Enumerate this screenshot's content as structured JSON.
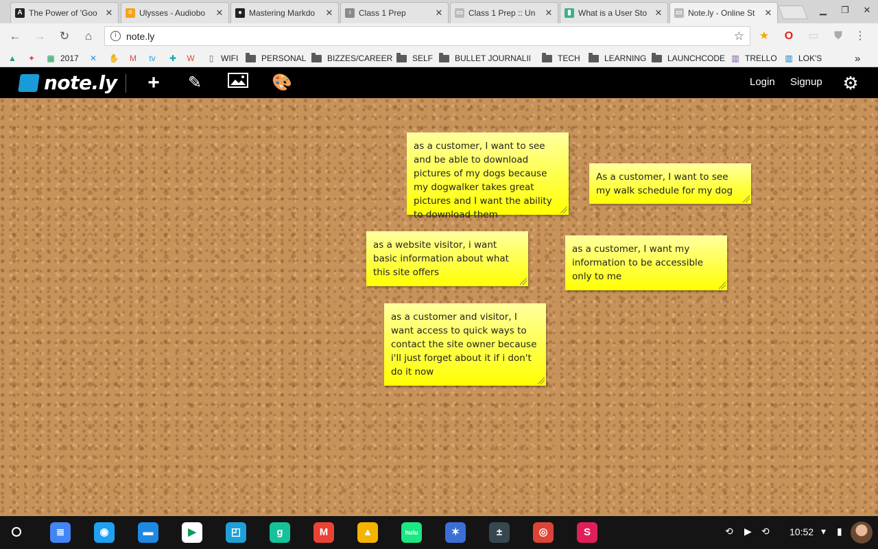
{
  "tabs": [
    {
      "title": "The Power of 'Goo",
      "favicon": "A",
      "color": "#222"
    },
    {
      "title": "Ulysses - Audiobo",
      "favicon": "≡",
      "color": "#f7a21b"
    },
    {
      "title": "Mastering Markdo",
      "favicon": "●",
      "color": "#222"
    },
    {
      "title": "Class 1 Prep",
      "favicon": "♀",
      "color": "#8a8a8a"
    },
    {
      "title": "Class 1 Prep :: Un",
      "favicon": "▭",
      "color": "#bbb"
    },
    {
      "title": "What is a User Sto",
      "favicon": "▮",
      "color": "#3bb08f"
    },
    {
      "title": "Note.ly - Online St",
      "favicon": "▭",
      "color": "#bbb"
    }
  ],
  "toolbar": {
    "url": "note.ly"
  },
  "bookmarks": [
    {
      "label": "",
      "icon": "▲",
      "color": "#1fa463"
    },
    {
      "label": "",
      "icon": "✦",
      "color": "#e44"
    },
    {
      "label": "2017",
      "icon": "▦",
      "color": "#0f9d58"
    },
    {
      "label": "",
      "icon": "✕",
      "color": "#2196f3"
    },
    {
      "label": "",
      "icon": "✋",
      "color": "#3a7"
    },
    {
      "label": "",
      "icon": "M",
      "color": "#d44"
    },
    {
      "label": "",
      "icon": "tv",
      "color": "#2aa0d8"
    },
    {
      "label": "",
      "icon": "✚",
      "color": "#1aa"
    },
    {
      "label": "",
      "icon": "W",
      "color": "#e8432e"
    },
    {
      "label": "WIFI",
      "icon": "▯",
      "color": "#666"
    },
    {
      "label": "PERSONAL",
      "icon": "folder"
    },
    {
      "label": "BIZZES/CAREER",
      "icon": "folder"
    },
    {
      "label": "SELF",
      "icon": "folder"
    },
    {
      "label": "BULLET JOURNALING",
      "icon": "folder"
    },
    {
      "label": "TECH",
      "icon": "folder"
    },
    {
      "label": "LEARNING",
      "icon": "folder"
    },
    {
      "label": "LAUNCHCODE",
      "icon": "folder"
    },
    {
      "label": "TRELLO",
      "icon": "▥",
      "color": "#7a4fa0"
    },
    {
      "label": "LOK'S",
      "icon": "▥",
      "color": "#0079bf"
    }
  ],
  "header": {
    "logo": "note.ly",
    "login": "Login",
    "signup": "Signup"
  },
  "notes": [
    {
      "text": "as a customer, I want to see and be able to download pictures of my dogs because my dogwalker takes great pictures and I want the ability to download them"
    },
    {
      "text": "As a customer, I want to see my walk schedule for my dog"
    },
    {
      "text": "as a website visitor, i want basic information about what this site offers"
    },
    {
      "text": "as a customer, I want my information to be accessible only to me"
    },
    {
      "text": "as a customer and visitor, I want access to quick ways to contact the site owner because i'll just forget about it if i don't do it now"
    }
  ],
  "shelf": {
    "apps": [
      {
        "name": "docs-icon",
        "glyph": "≣",
        "color": "#4285f4"
      },
      {
        "name": "camera-icon",
        "glyph": "◉",
        "color": "#1ea1f1"
      },
      {
        "name": "files-icon",
        "glyph": "▬",
        "color": "#1e88e5"
      },
      {
        "name": "play-store-icon",
        "glyph": "▶",
        "color": "#fff"
      },
      {
        "name": "screen-icon",
        "glyph": "◰",
        "color": "#1e9fd8"
      },
      {
        "name": "grammarly-icon",
        "glyph": "g",
        "color": "#15c39a"
      },
      {
        "name": "gmail-icon",
        "glyph": "M",
        "color": "#ea4335"
      },
      {
        "name": "drive-icon",
        "glyph": "▲",
        "color": "#f4b400"
      },
      {
        "name": "hulu-icon",
        "glyph": "hulu",
        "color": "#1ce783"
      },
      {
        "name": "butterfly-icon",
        "glyph": "✶",
        "color": "#3b6fd6"
      },
      {
        "name": "calculator-icon",
        "glyph": "±",
        "color": "#37474f"
      },
      {
        "name": "chrome-icon",
        "glyph": "◎",
        "color": "#db4437"
      },
      {
        "name": "slack-icon",
        "glyph": "S",
        "color": "#e01e5a"
      }
    ],
    "clock": "10:52"
  }
}
